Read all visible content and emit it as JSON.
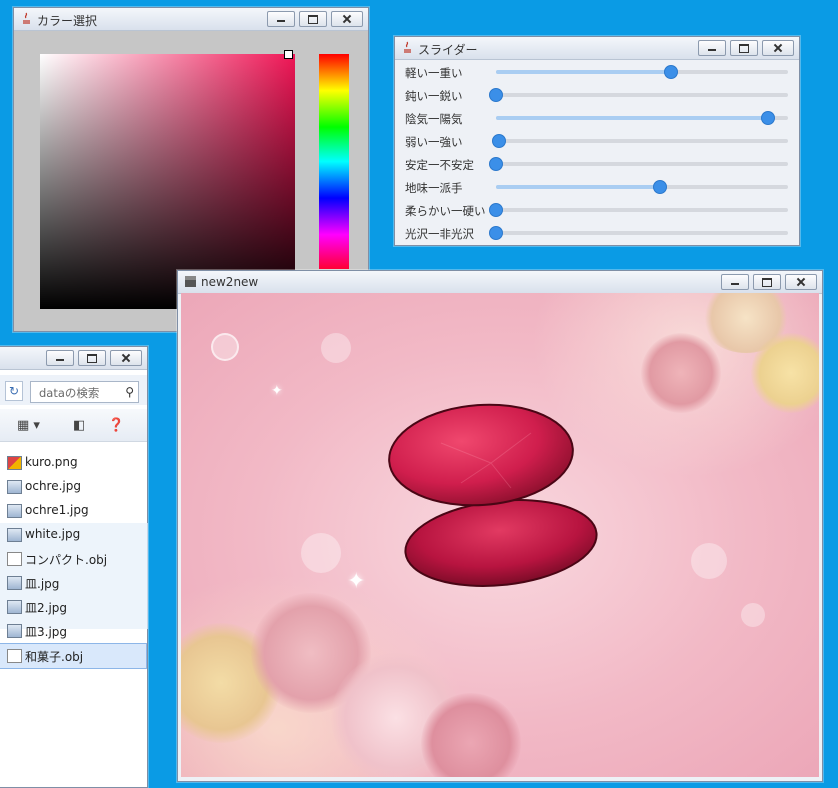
{
  "color_chooser": {
    "title": "カラー選択",
    "selected_color": "#f01656"
  },
  "sliders": {
    "title": "スライダー",
    "items": [
      {
        "label": "軽い一重い",
        "value": 0.6
      },
      {
        "label": "鈍い一鋭い",
        "value": 0.0
      },
      {
        "label": "陰気一陽気",
        "value": 0.93
      },
      {
        "label": "弱い一強い",
        "value": 0.01
      },
      {
        "label": "安定一不安定",
        "value": 0.0
      },
      {
        "label": "地味一派手",
        "value": 0.56
      },
      {
        "label": "柔らかい一硬い",
        "value": 0.0
      },
      {
        "label": "光沢一非光沢",
        "value": 0.0
      }
    ]
  },
  "explorer": {
    "search_placeholder": "dataの検索",
    "files": [
      {
        "name": "kuro.png",
        "icon": "png-icon"
      },
      {
        "name": "ochre.jpg",
        "icon": "jpg-icon"
      },
      {
        "name": "ochre1.jpg",
        "icon": "jpg-icon"
      },
      {
        "name": "white.jpg",
        "icon": "jpg-icon"
      },
      {
        "name": "コンパクト.obj",
        "icon": "obj-icon"
      },
      {
        "name": "皿.jpg",
        "icon": "jpg-icon"
      },
      {
        "name": "皿2.jpg",
        "icon": "jpg-icon"
      },
      {
        "name": "皿3.jpg",
        "icon": "jpg-icon"
      },
      {
        "name": "和菓子.obj",
        "icon": "obj-icon"
      }
    ],
    "selected_index": 8
  },
  "viewer": {
    "title": "new2new"
  }
}
